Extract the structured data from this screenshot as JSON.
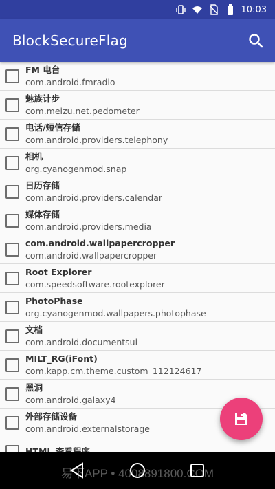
{
  "status_bar": {
    "time": "10:03",
    "icons": [
      "vibrate-icon",
      "wifi-icon",
      "no-sim-icon",
      "battery-icon"
    ]
  },
  "app_bar": {
    "title": "BlockSecureFlag",
    "search_icon": "search-icon"
  },
  "apps": [
    {
      "title": "FM 电台",
      "package": "com.android.fmradio"
    },
    {
      "title": "魅族计步",
      "package": "com.meizu.net.pedometer"
    },
    {
      "title": "电话/短信存储",
      "package": "com.android.providers.telephony"
    },
    {
      "title": "相机",
      "package": "org.cyanogenmod.snap"
    },
    {
      "title": "日历存储",
      "package": "com.android.providers.calendar"
    },
    {
      "title": "媒体存储",
      "package": "com.android.providers.media"
    },
    {
      "title": "com.android.wallpapercropper",
      "package": "com.android.wallpapercropper"
    },
    {
      "title": "Root Explorer",
      "package": "com.speedsoftware.rootexplorer"
    },
    {
      "title": "PhotoPhase",
      "package": "org.cyanogenmod.wallpapers.photophase"
    },
    {
      "title": "文档",
      "package": "com.android.documentsui"
    },
    {
      "title": "MILT_RG(iFont)",
      "package": "com.kapp.cm.theme.custom_112124617"
    },
    {
      "title": "黑洞",
      "package": "com.android.galaxy4"
    },
    {
      "title": "外部存储设备",
      "package": "com.android.externalstorage"
    },
    {
      "title": "HTML 查看程序",
      "package": ""
    }
  ],
  "fab": {
    "icon": "save-icon"
  },
  "nav_bar": {
    "icons": [
      "back-icon",
      "home-icon",
      "recents-icon"
    ]
  },
  "watermark": "易下APP • 4008891800.COM",
  "colors": {
    "primary": "#3f51b5",
    "primary_dark": "#303f9f",
    "accent": "#ec407a"
  }
}
